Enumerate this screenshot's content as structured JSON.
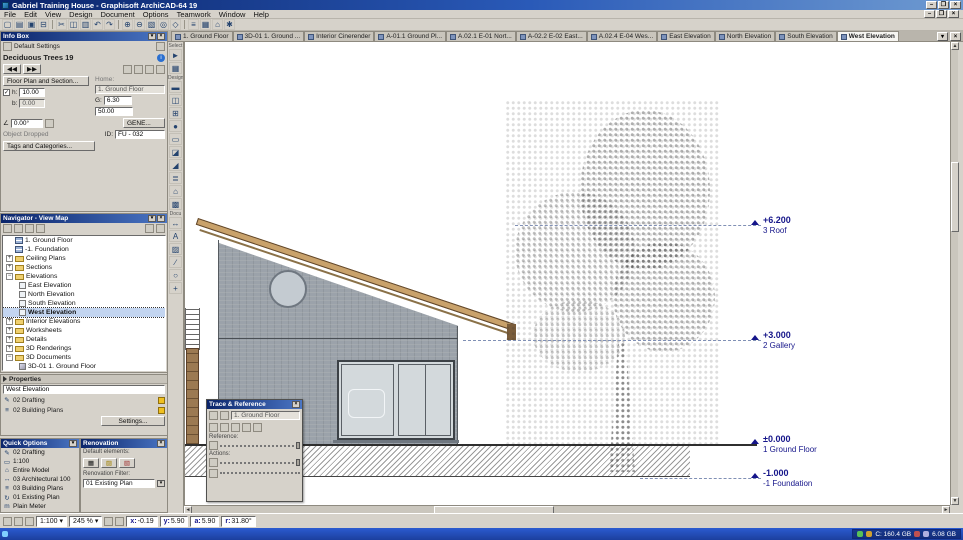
{
  "window": {
    "title": "Gabriel Training House - Graphisoft ArchiCAD-64 19",
    "controls": {
      "minimize": "–",
      "restore": "❐",
      "close": "×"
    }
  },
  "ui": {
    "dropdown": "▾",
    "menu": "≡",
    "check": "✓",
    "left_arrow": "◄",
    "right_arrow": "►",
    "up_arrow": "▲",
    "down_arrow": "▼"
  },
  "menu": {
    "items": [
      "File",
      "Edit",
      "View",
      "Design",
      "Document",
      "Options",
      "Teamwork",
      "Window",
      "Help"
    ]
  },
  "toolbar": {
    "icons": [
      {
        "name": "new-file-icon",
        "glyph": "▢"
      },
      {
        "name": "open-file-icon",
        "glyph": "▤"
      },
      {
        "name": "save-icon",
        "glyph": "▣"
      },
      {
        "name": "print-icon",
        "glyph": "⊟"
      },
      {
        "name": "cut-icon",
        "glyph": "✂"
      },
      {
        "name": "copy-icon",
        "glyph": "◫"
      },
      {
        "name": "paste-icon",
        "glyph": "▥"
      },
      {
        "name": "undo-icon",
        "glyph": "↶"
      },
      {
        "name": "redo-icon",
        "glyph": "↷"
      },
      {
        "name": "zoom-in-icon",
        "glyph": "⊕"
      },
      {
        "name": "zoom-out-icon",
        "glyph": "⊖"
      },
      {
        "name": "fit-in-window-icon",
        "glyph": "▧"
      },
      {
        "name": "orbit-icon",
        "glyph": "◎"
      },
      {
        "name": "3d-window-icon",
        "glyph": "◇"
      },
      {
        "name": "layer-settings-icon",
        "glyph": "≡"
      },
      {
        "name": "grid-snap-icon",
        "glyph": "▦"
      },
      {
        "name": "gravity-icon",
        "glyph": "⌂"
      },
      {
        "name": "options-icon",
        "glyph": "✱"
      }
    ]
  },
  "tabbar": {
    "tabs": [
      {
        "label": "1. Ground Floor"
      },
      {
        "label": "3D-01 1. Ground ..."
      },
      {
        "label": "Interior Cinerender"
      },
      {
        "label": "A-01.1 Ground Pl..."
      },
      {
        "label": "A.02.1 E-01 Nort..."
      },
      {
        "label": "A-02.2 E-02 East..."
      },
      {
        "label": "A.02.4 E-04 Wes..."
      },
      {
        "label": "East Elevation"
      },
      {
        "label": "North Elevation"
      },
      {
        "label": "South Elevation"
      },
      {
        "label": "West Elevation"
      }
    ]
  },
  "toolbox": {
    "sections": [
      "Select",
      "Design",
      "Docu"
    ],
    "tools": [
      {
        "name": "arrow-tool-icon",
        "glyph": "►"
      },
      {
        "name": "marquee-tool-icon",
        "glyph": "▦"
      },
      {
        "name": "wall-tool-icon",
        "glyph": "▬"
      },
      {
        "name": "door-tool-icon",
        "glyph": "◫"
      },
      {
        "name": "window-tool-icon",
        "glyph": "⊞"
      },
      {
        "name": "column-tool-icon",
        "glyph": "●"
      },
      {
        "name": "beam-tool-icon",
        "glyph": "▭"
      },
      {
        "name": "slab-tool-icon",
        "glyph": "◪"
      },
      {
        "name": "roof-tool-icon",
        "glyph": "◢"
      },
      {
        "name": "stair-tool-icon",
        "glyph": "≣"
      },
      {
        "name": "object-tool-icon",
        "glyph": "⌂"
      },
      {
        "name": "zone-tool-icon",
        "glyph": "▩"
      },
      {
        "name": "dimension-tool-icon",
        "glyph": "↔"
      },
      {
        "name": "text-tool-icon",
        "glyph": "A"
      },
      {
        "name": "fill-tool-icon",
        "glyph": "▨"
      },
      {
        "name": "line-tool-icon",
        "glyph": "∕"
      },
      {
        "name": "circle-tool-icon",
        "glyph": "○"
      },
      {
        "name": "hotspot-tool-icon",
        "glyph": "+"
      }
    ]
  },
  "infobox": {
    "title": "Info Box",
    "default_settings_label": "Default Settings",
    "element_name": "Deciduous Trees 19",
    "prev_label": "◀◀",
    "next_label": "▶▶",
    "floorplan_button": "Floor Plan and Section...",
    "home_label": "Home:",
    "home_value": "1. Ground Floor",
    "h_label": "h:",
    "h_value": "10.00",
    "b_label": "b:",
    "b_value": "0.00",
    "g_label": "G:",
    "g_value": "6.30",
    "g2_value": "50.00",
    "angle_value": "0.00°",
    "gene_button": "GENE...",
    "dropped_label": "Object Dropped",
    "id_label": "ID:",
    "id_value": "FU - 032",
    "tags_button": "Tags and Categories..."
  },
  "navigator": {
    "title": "Navigator - View Map",
    "items": [
      {
        "label": "1. Ground Floor",
        "exp": ""
      },
      {
        "label": "-1. Foundation",
        "exp": ""
      },
      {
        "label": "Ceiling Plans",
        "exp": "+"
      },
      {
        "label": "Sections",
        "exp": "+"
      },
      {
        "label": "Elevations",
        "exp": "−"
      },
      {
        "label": "East Elevation",
        "exp": ""
      },
      {
        "label": "North Elevation",
        "exp": ""
      },
      {
        "label": "South Elevation",
        "exp": ""
      },
      {
        "label": "West Elevation",
        "exp": ""
      },
      {
        "label": "Interior Elevations",
        "exp": "+"
      },
      {
        "label": "Worksheets",
        "exp": "+"
      },
      {
        "label": "Details",
        "exp": "+"
      },
      {
        "label": "3D Renderings",
        "exp": "+"
      },
      {
        "label": "3D Documents",
        "exp": "−"
      },
      {
        "label": "3D-01 1. Ground Floor",
        "exp": ""
      }
    ]
  },
  "properties": {
    "header": "Properties",
    "name_value": "West Elevation",
    "rows": [
      {
        "label": "02 Drafting"
      },
      {
        "label": "02 Building Plans"
      }
    ],
    "settings_button": "Settings..."
  },
  "quick_options": {
    "title": "Quick Options",
    "items": [
      {
        "glyph": "✎",
        "label": "02 Drafting"
      },
      {
        "glyph": "▭",
        "label": "1:100"
      },
      {
        "glyph": "⌂",
        "label": "Entire Model"
      },
      {
        "glyph": "↔",
        "label": "03 Architectural 100"
      },
      {
        "glyph": "≡",
        "label": "03 Building Plans"
      },
      {
        "glyph": "↻",
        "label": "01 Existing Plan"
      },
      {
        "glyph": "m",
        "label": "Plain Meter"
      }
    ]
  },
  "renovation": {
    "title": "Renovation",
    "default_label": "Default elements:",
    "filter_label": "Renovation Filter:",
    "filter_value": "01 Existing Plan"
  },
  "trace": {
    "title": "Trace & Reference",
    "layer": "1. Ground Floor",
    "reference_label": "Reference:",
    "actions_label": "Actions:"
  },
  "canvas": {
    "levels": [
      {
        "value": "+6.200",
        "name": "3 Roof"
      },
      {
        "value": "+3.000",
        "name": "2 Gallery"
      },
      {
        "value": "±0.000",
        "name": "1 Ground Floor"
      },
      {
        "value": "-1.000",
        "name": "-1 Foundation"
      }
    ]
  },
  "statusbar": {
    "scale": "1:100",
    "zoom": "245 %",
    "coords": [
      {
        "label": "x:",
        "value": "-0.19"
      },
      {
        "label": "y:",
        "value": "5.90"
      },
      {
        "label": "a:",
        "value": "5.90"
      },
      {
        "label": "r:",
        "value": "31.80°"
      }
    ]
  },
  "taskbar": {
    "disk": "C: 160.4 GB",
    "memory": "6.08 GB"
  }
}
